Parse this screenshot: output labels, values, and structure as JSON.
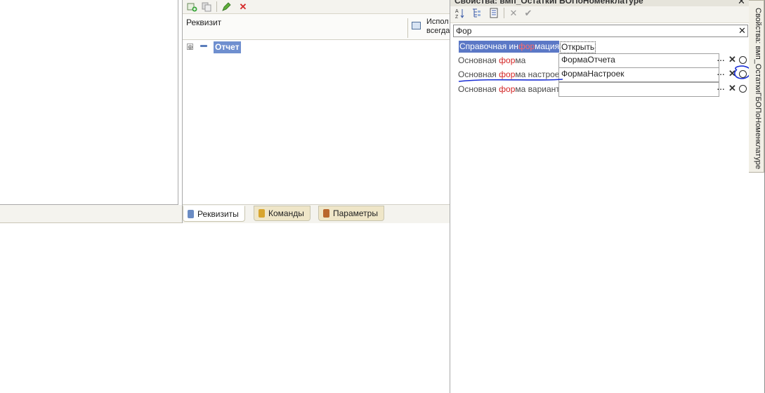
{
  "middle_panel": {
    "columns": {
      "attribute": "Реквизит",
      "use_line1": "Испол",
      "use_line2": "всегда"
    },
    "tree": {
      "root_label": "Отчет",
      "expand_glyph": "⊕"
    },
    "tabs": [
      {
        "label": "Реквизиты",
        "icon": "attributes-icon",
        "color": "#6b8cc4"
      },
      {
        "label": "Команды",
        "icon": "commands-icon",
        "color": "#d8a52e"
      },
      {
        "label": "Параметры",
        "icon": "parameters-icon",
        "color": "#b9672d"
      }
    ]
  },
  "properties": {
    "title": "Свойства: вмп_ОстаткиГБОПоНоменклатуре",
    "search": {
      "value": "Фор"
    },
    "rows": [
      {
        "label_pre": "Справочная ин",
        "label_hl": "фор",
        "label_post": "мация",
        "value": "Открыть"
      },
      {
        "label_pre": "Основная ",
        "label_hl": "фор",
        "label_post": "ма",
        "value": "ФормаОтчета"
      },
      {
        "label_pre": "Основная ",
        "label_hl": "фор",
        "label_post": "ма настроек",
        "value": "ФормаНастроек"
      },
      {
        "label_pre": "Основная ",
        "label_hl": "фор",
        "label_post": "ма варианта",
        "value": ""
      }
    ],
    "field_buttons": {
      "choose": "...",
      "clear": "✕"
    },
    "side_tab_label": "Свойства: вмп_ОстаткиГБОПоНоменклатуре"
  },
  "icons": {
    "add": "add-icon",
    "copy": "copy-icon",
    "edit": "pencil-icon",
    "delete": "delete-icon",
    "sort": "sort-alpha-icon",
    "categories": "categories-icon",
    "filter": "filter-icon",
    "cancel": "cancel-icon",
    "apply": "check-icon",
    "search": "magnifier-icon"
  },
  "colors": {
    "accent_selection": "#5b78c6",
    "match_highlight": "#d32525",
    "annotation_ink": "#1a2fd6"
  }
}
